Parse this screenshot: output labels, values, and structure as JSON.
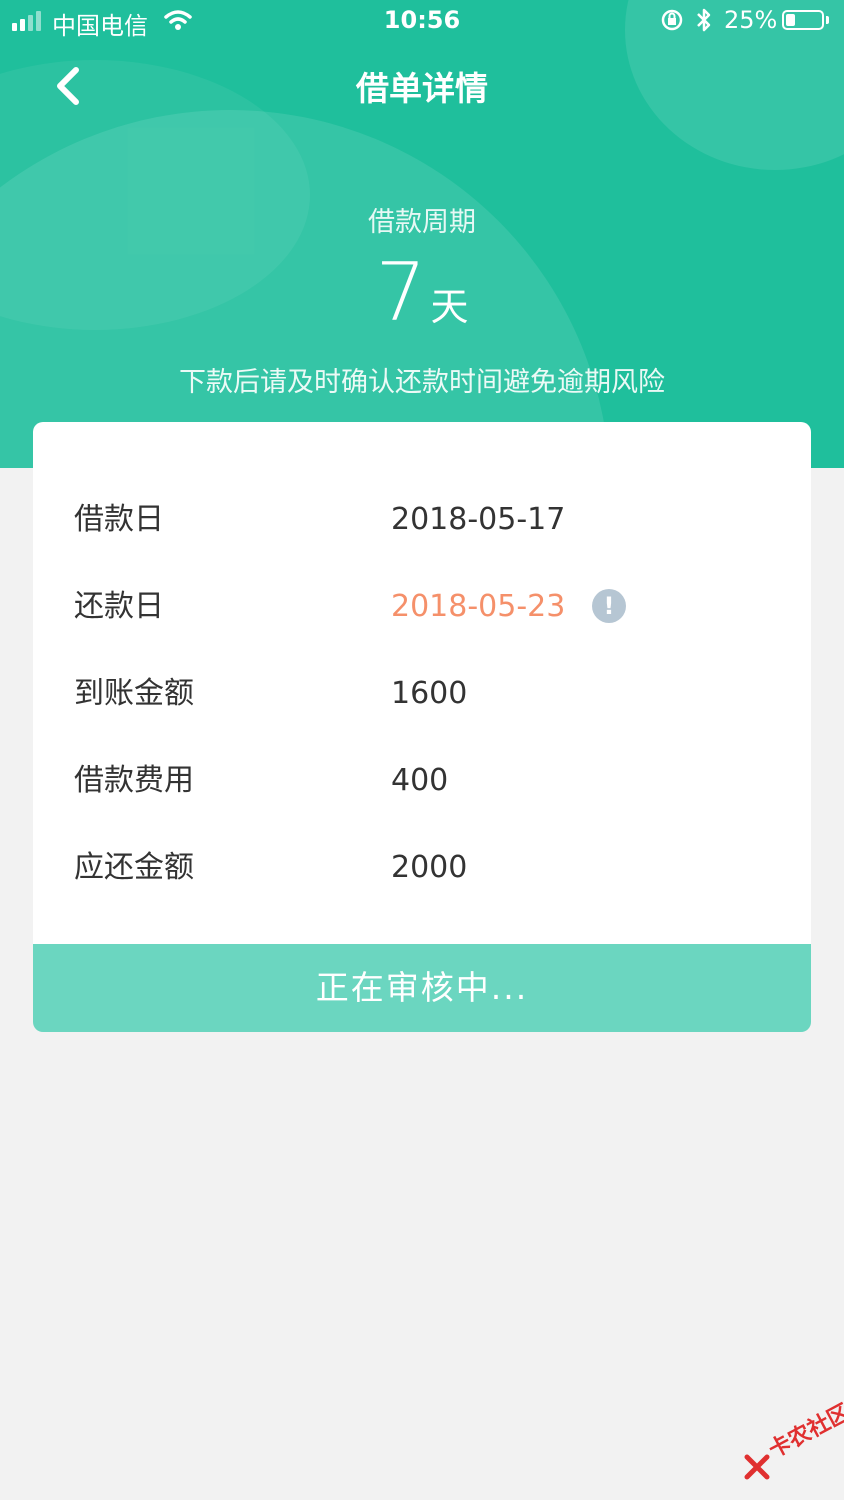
{
  "status_bar": {
    "carrier": "中国电信",
    "time": "10:56",
    "battery_percent": "25%",
    "battery_level": 0.25
  },
  "nav": {
    "title": "借单详情"
  },
  "summary": {
    "period_label": "借款周期",
    "period_value": "7",
    "period_unit": "天",
    "hint": "下款后请及时确认还款时间避免逾期风险"
  },
  "details": [
    {
      "label": "借款日",
      "value": "2018-05-17"
    },
    {
      "label": "还款日",
      "value": "2018-05-23",
      "highlight": true,
      "info": "!"
    },
    {
      "label": "到账金额",
      "value": "1600"
    },
    {
      "label": "借款费用",
      "value": "400"
    },
    {
      "label": "应还金额",
      "value": "2000"
    }
  ],
  "status_button": {
    "label": "正在审核中..."
  },
  "watermark": {
    "text": "卡农社区"
  },
  "colors": {
    "brand": "#1fbf9c",
    "button": "#6bd6c0",
    "highlight": "#f5906a",
    "background": "#f2f2f2"
  }
}
